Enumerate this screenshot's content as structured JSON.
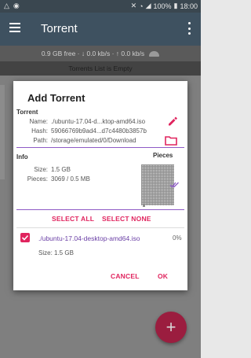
{
  "statusbar": {
    "icons_left": [
      "upload-icon",
      "notification-icon"
    ],
    "icons_right": [
      "mute-icon",
      "wifi-icon",
      "signal-icon"
    ],
    "battery": "100%",
    "time": "18:00"
  },
  "appbar": {
    "title": "Torrent"
  },
  "speedbar": {
    "text": "0.9 GB free · ↓ 0.0 kb/s · ↑ 0.0 kb/s"
  },
  "list": {
    "empty_text": "Torrents List is Empty"
  },
  "dialog": {
    "title": "Add Torrent",
    "torrent_section": "Torrent",
    "name_label": "Name:",
    "name_value": "./ubuntu-17.04-d...ktop-amd64.iso",
    "hash_label": "Hash:",
    "hash_value": "59066769b9ad4...d7c4480b3857b",
    "path_label": "Path:",
    "path_value": "/storage/emulated/0/Download",
    "info_section": "Info",
    "pieces_heading": "Pieces",
    "size_label": "Size:",
    "size_value": "1.5 GB",
    "pieces_label": "Pieces:",
    "pieces_value": "3069 / 0.5 MB",
    "select_all": "SELECT ALL",
    "select_none": "SELECT NONE",
    "file_name": "./ubuntu-17.04-desktop-amd64.iso",
    "file_percent": "0%",
    "file_size": "Size: 1.5 GB",
    "cancel": "CANCEL",
    "ok": "OK"
  },
  "fab": {
    "label": "+"
  },
  "colors": {
    "appbar": "#3e5160",
    "accent": "#e0245e",
    "divider": "#8e5bc6"
  }
}
